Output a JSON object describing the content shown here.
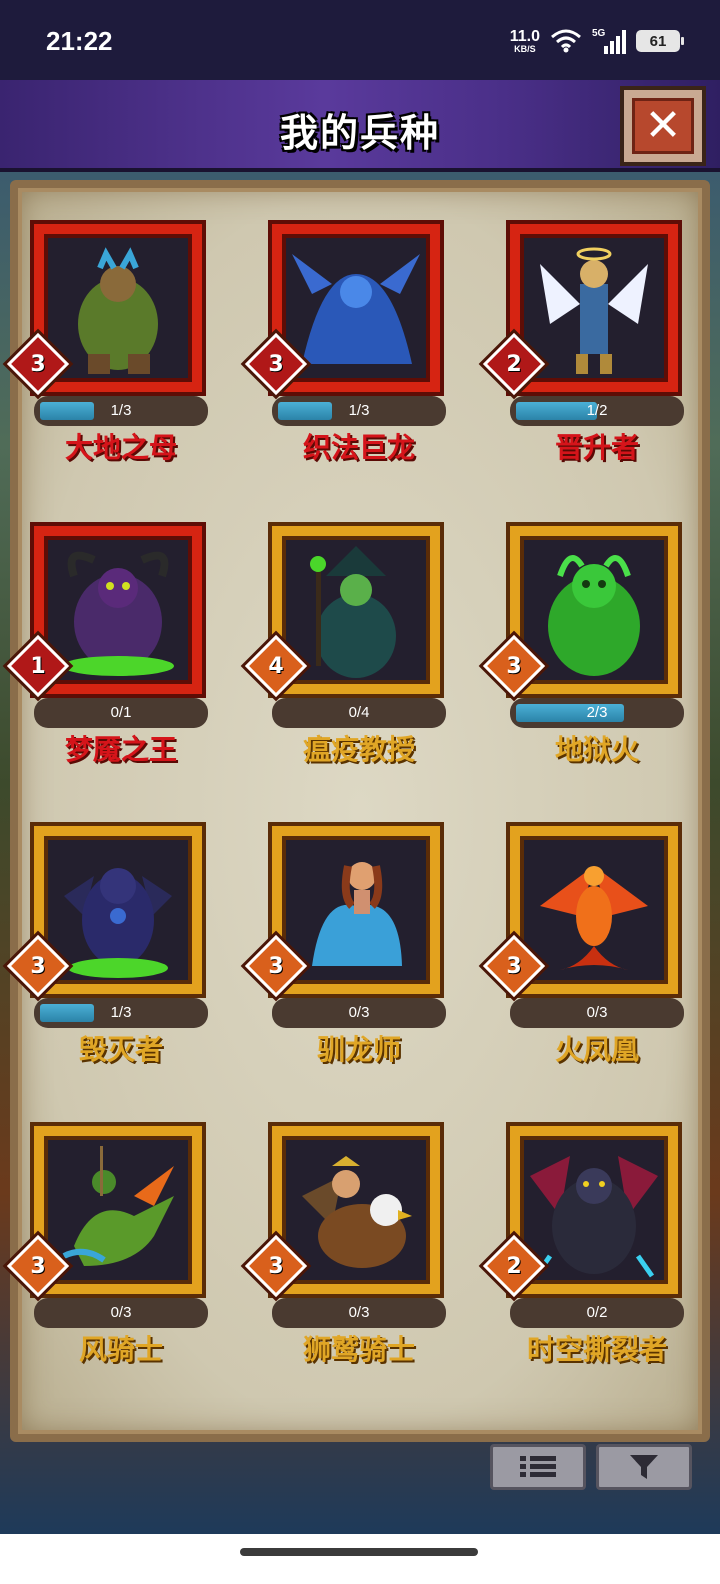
{
  "status": {
    "time": "21:22",
    "speed_value": "11.0",
    "speed_unit": "KB/S",
    "network": "5G",
    "battery": "61"
  },
  "header": {
    "title": "我的兵种"
  },
  "units": [
    {
      "name": "大地之母",
      "level": "3",
      "progress_text": "1/3",
      "progress": 0.333,
      "rarity": "red"
    },
    {
      "name": "织法巨龙",
      "level": "3",
      "progress_text": "1/3",
      "progress": 0.333,
      "rarity": "red"
    },
    {
      "name": "晋升者",
      "level": "2",
      "progress_text": "1/2",
      "progress": 0.5,
      "rarity": "red"
    },
    {
      "name": "梦魇之王",
      "level": "1",
      "progress_text": "0/1",
      "progress": 0,
      "rarity": "red"
    },
    {
      "name": "瘟疫教授",
      "level": "4",
      "progress_text": "0/4",
      "progress": 0,
      "rarity": "gold"
    },
    {
      "name": "地狱火",
      "level": "3",
      "progress_text": "2/3",
      "progress": 0.667,
      "rarity": "gold"
    },
    {
      "name": "毁灭者",
      "level": "3",
      "progress_text": "1/3",
      "progress": 0.333,
      "rarity": "gold"
    },
    {
      "name": "驯龙师",
      "level": "3",
      "progress_text": "0/3",
      "progress": 0,
      "rarity": "gold"
    },
    {
      "name": "火凤凰",
      "level": "3",
      "progress_text": "0/3",
      "progress": 0,
      "rarity": "gold"
    },
    {
      "name": "风骑士",
      "level": "3",
      "progress_text": "0/3",
      "progress": 0,
      "rarity": "gold"
    },
    {
      "name": "狮鹫骑士",
      "level": "3",
      "progress_text": "0/3",
      "progress": 0,
      "rarity": "gold"
    },
    {
      "name": "时空撕裂者",
      "level": "2",
      "progress_text": "0/2",
      "progress": 0,
      "rarity": "gold"
    }
  ],
  "icons": {
    "close": "close-icon",
    "list": "list-icon",
    "filter": "filter-icon"
  },
  "colors": {
    "header_bg": "#4a2f88",
    "rare_frame": "#d62412",
    "common_frame": "#e3a21e",
    "progress_fill": "#2b83a8"
  }
}
